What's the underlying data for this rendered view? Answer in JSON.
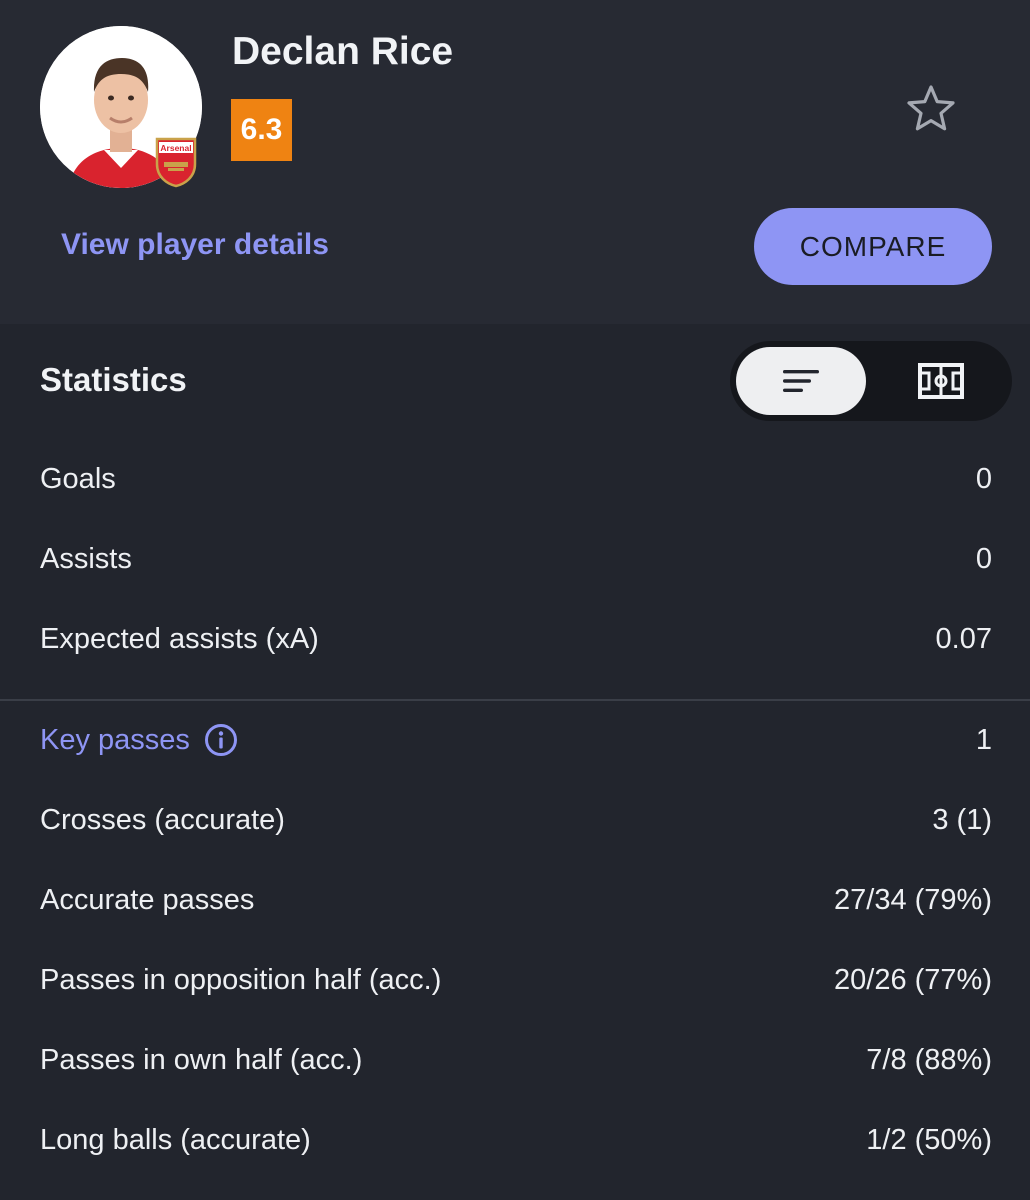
{
  "player": {
    "name": "Declan Rice",
    "rating": "6.3",
    "team_badge_text": "Arsenal"
  },
  "actions": {
    "view_details": "View player details",
    "compare": "COMPARE"
  },
  "colors": {
    "background": "#22252d",
    "header_background": "#272a33",
    "accent": "#8e95f4",
    "rating": "#ef8312"
  },
  "icons": {
    "favorite": "star-outline-icon",
    "list_view": "list-icon",
    "pitch_view": "pitch-icon",
    "info": "info-icon"
  },
  "statistics": {
    "title": "Statistics",
    "summary": [
      {
        "label": "Goals",
        "value": "0"
      },
      {
        "label": "Assists",
        "value": "0"
      },
      {
        "label": "Expected assists (xA)",
        "value": "0.07"
      }
    ],
    "passing": [
      {
        "label": "Key passes",
        "value": "1"
      },
      {
        "label": "Crosses (accurate)",
        "value": "3 (1)"
      },
      {
        "label": "Accurate passes",
        "value": "27/34 (79%)"
      },
      {
        "label": "Passes in opposition half (acc.)",
        "value": "20/26 (77%)"
      },
      {
        "label": "Passes in own half (acc.)",
        "value": "7/8 (88%)"
      },
      {
        "label": "Long balls (accurate)",
        "value": "1/2 (50%)"
      }
    ]
  }
}
